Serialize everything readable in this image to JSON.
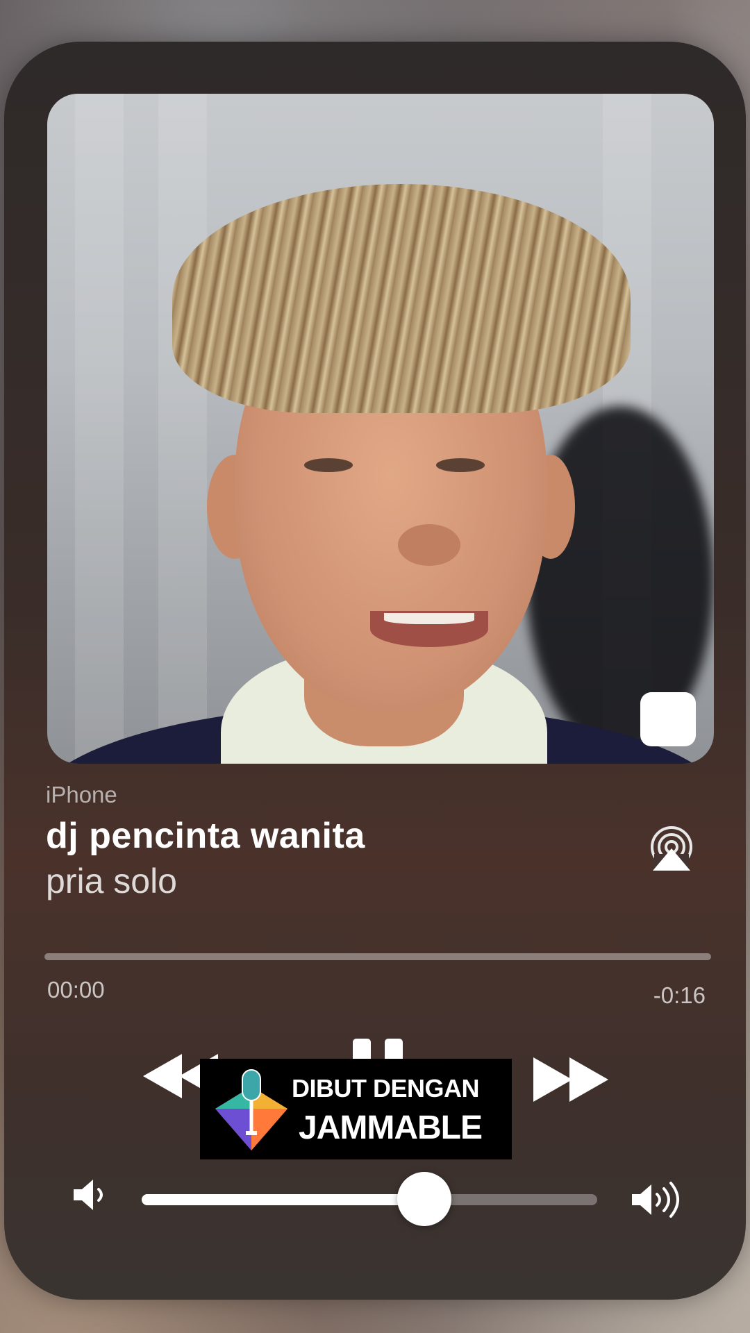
{
  "now_playing": {
    "source": "iPhone",
    "title": "dj pencinta wanita",
    "artist": "pria solo"
  },
  "artwork": {
    "description_icon": "album-artwork"
  },
  "progress": {
    "elapsed": "00:00",
    "remaining": "-0:16",
    "fraction": 0.0
  },
  "controls": {
    "rewind_icon": "rewind-icon",
    "pause_icon": "pause-icon",
    "forward_icon": "fast-forward-icon",
    "stop_icon": "stop-icon",
    "airplay_icon": "airplay-icon"
  },
  "volume": {
    "level": 0.62,
    "low_icon": "speaker-low-icon",
    "high_icon": "speaker-high-icon"
  },
  "watermark": {
    "line1": "DIBUT DENGAN",
    "line2": "JAMMABLE"
  },
  "colors": {
    "card": "#3a2d29",
    "accent": "#ffffff"
  }
}
